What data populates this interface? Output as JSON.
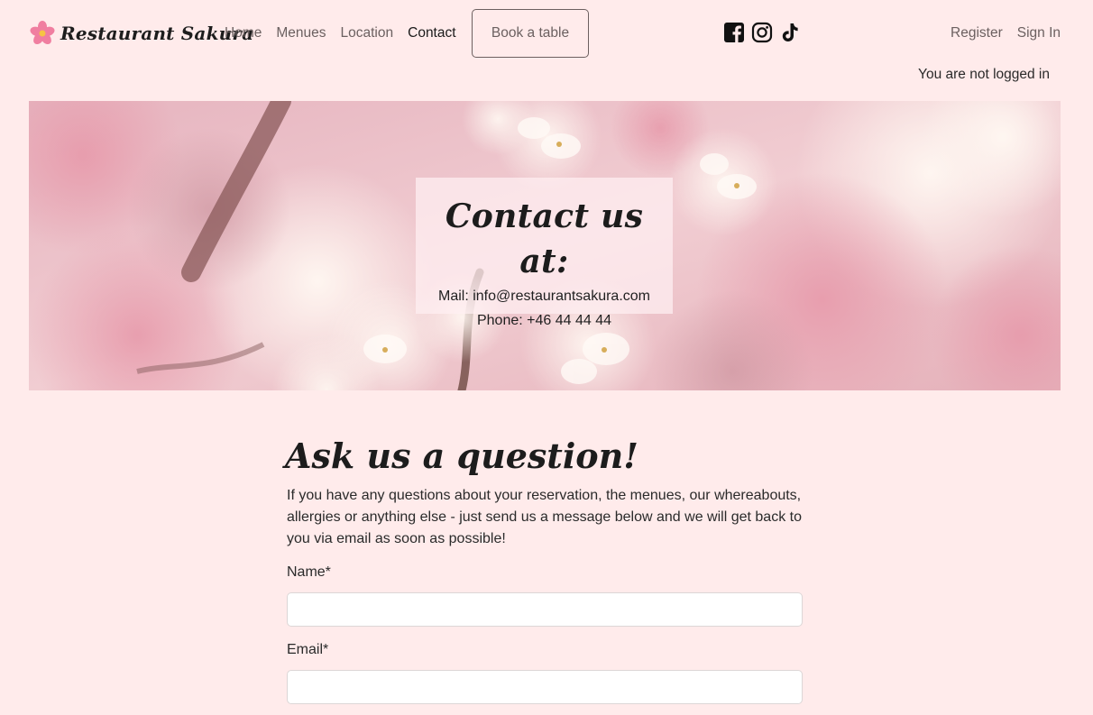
{
  "navbar": {
    "brand": "Restaurant Sakura",
    "links": [
      "Home",
      "Menues",
      "Location",
      "Contact"
    ],
    "active": "Contact",
    "book_button": "Book a table",
    "socials": [
      "facebook-icon",
      "instagram-icon",
      "tiktok-icon"
    ],
    "auth": {
      "register": "Register",
      "sign_in": "Sign In"
    },
    "login_status": "You are not logged in"
  },
  "hero": {
    "title": "Contact us at:",
    "mail": "Mail: info@restaurantsakura.com",
    "phone": "Phone: +46 44 44 44"
  },
  "form": {
    "title": "Ask us a question!",
    "description": "If you have any questions about your reservation, the menues, our whereabouts, allergies or anything else - just send us a message below and we will get back to you via email as soon as possible!",
    "name_label": "Name*",
    "name_value": "",
    "email_label": "Email*",
    "email_value": ""
  },
  "colors": {
    "page_bg": "#ffebeb",
    "text": "#222222",
    "muted_link": "#6b6060",
    "blossom": "#f3b9c4"
  }
}
